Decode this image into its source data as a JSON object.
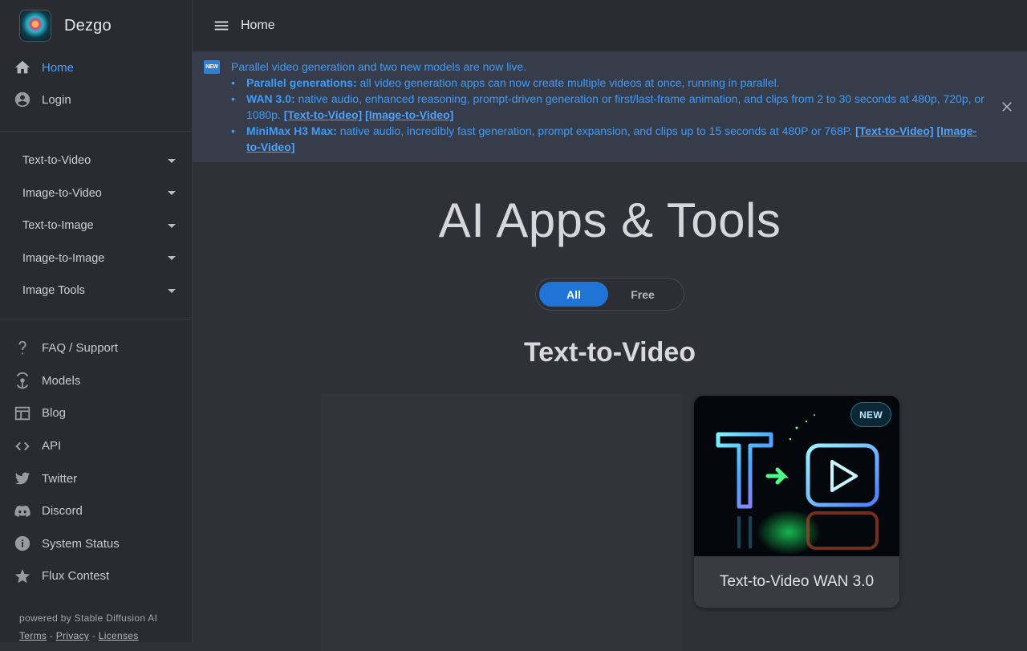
{
  "app": {
    "name": "Dezgo"
  },
  "topbar": {
    "title": "Home"
  },
  "sidebar": {
    "primary": [
      {
        "label": "Home",
        "icon": "home-icon",
        "active": true
      },
      {
        "label": "Login",
        "icon": "account-icon",
        "active": false
      }
    ],
    "categories": [
      {
        "label": "Text-to-Video"
      },
      {
        "label": "Image-to-Video"
      },
      {
        "label": "Text-to-Image"
      },
      {
        "label": "Image-to-Image"
      },
      {
        "label": "Image Tools"
      }
    ],
    "links": [
      {
        "label": "FAQ / Support",
        "icon": "question-icon"
      },
      {
        "label": "Models",
        "icon": "models-icon"
      },
      {
        "label": "Blog",
        "icon": "blog-icon"
      },
      {
        "label": "API",
        "icon": "code-icon"
      },
      {
        "label": "Twitter",
        "icon": "twitter-icon"
      },
      {
        "label": "Discord",
        "icon": "discord-icon"
      },
      {
        "label": "System Status",
        "icon": "info-icon"
      },
      {
        "label": "Flux Contest",
        "icon": "star-icon"
      }
    ],
    "footer": {
      "powered": "powered by Stable Diffusion AI",
      "terms": "Terms",
      "sep1": "-",
      "privacy": "Privacy",
      "sep2": "-",
      "licenses": "Licenses"
    }
  },
  "banner": {
    "badge": "NEW",
    "headline": "Parallel video generation and two new models are now live.",
    "items": [
      {
        "title": "Parallel generations:",
        "text": " all video generation apps can now create multiple videos at once, running in parallel.",
        "links": []
      },
      {
        "title": "WAN 3.0:",
        "text": " native audio, enhanced reasoning, prompt-driven generation or first/last-frame animation, and clips from 2 to 30 seconds at 480p, 720p, or 1080p. ",
        "links": [
          "[Text-to-Video]",
          "[Image-to-Video]"
        ]
      },
      {
        "title": "MiniMax H3 Max:",
        "text": " native audio, incredibly fast generation, prompt expansion, and clips up to 15 seconds at 480P or 768P. ",
        "links": [
          "[Text-to-Video]",
          "[Image-to-Video]"
        ]
      }
    ]
  },
  "main": {
    "title": "AI Apps & Tools",
    "filter": {
      "options": [
        "All",
        "Free"
      ],
      "selected": "All"
    },
    "section": "Text-to-Video",
    "cards": [
      {
        "label": "Text-to-Video WAN 3.0",
        "badge": "NEW"
      }
    ]
  },
  "colors": {
    "accent": "#1f74d6",
    "link": "#4aa3ff",
    "background": "#303039",
    "sidebar": "#2a2a31"
  }
}
